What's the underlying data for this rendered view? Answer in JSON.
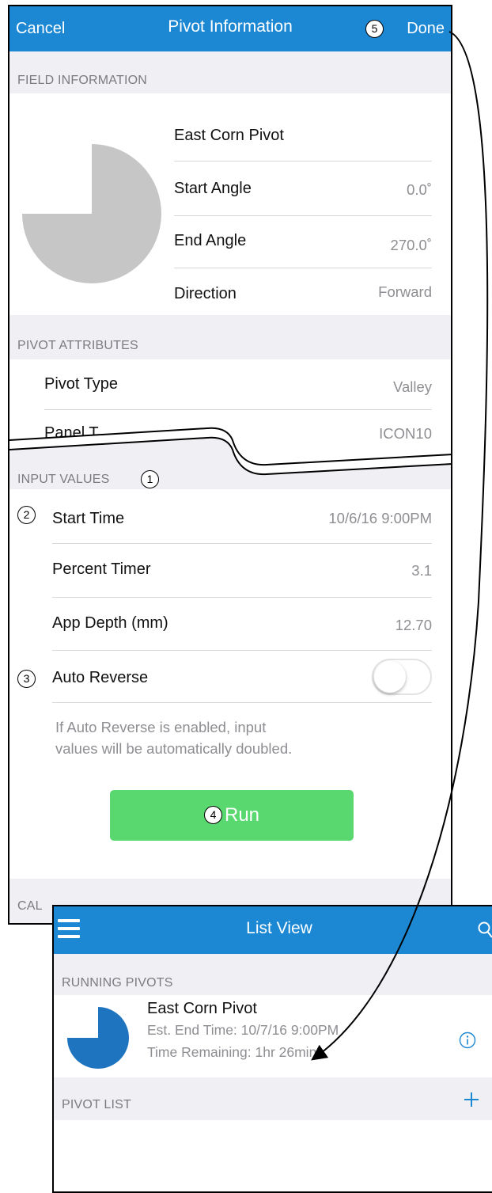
{
  "pivot_info": {
    "nav": {
      "cancel": "Cancel",
      "title": "Pivot Information",
      "done": "Done",
      "done_callout": "5"
    },
    "field_information": {
      "header": "FIELD INFORMATION",
      "name": "East Corn Pivot",
      "start_angle": {
        "label": "Start Angle",
        "value": "0.0˚"
      },
      "end_angle": {
        "label": "End Angle",
        "value": "270.0˚"
      },
      "direction": {
        "label": "Direction",
        "value": "Forward"
      },
      "coverage_fraction": 0.75
    },
    "pivot_attributes": {
      "header": "PIVOT ATTRIBUTES",
      "pivot_type": {
        "label": "Pivot Type",
        "value": "Valley"
      },
      "panel_type": {
        "label": "Panel T",
        "value": "ICON10"
      }
    },
    "input_values": {
      "header": "INPUT VALUES",
      "header_callout": "1",
      "start_time": {
        "label": "Start Time",
        "value": "10/6/16  9:00PM",
        "callout": "2"
      },
      "percent_timer": {
        "label": "Percent Timer",
        "value": "3.1"
      },
      "app_depth": {
        "label": "App Depth (mm)",
        "value": "12.70"
      },
      "auto_reverse": {
        "label": "Auto Reverse",
        "enabled": false,
        "callout": "3"
      },
      "hint_line1": "If Auto Reverse is enabled, input",
      "hint_line2": "values will be automatically doubled.",
      "run_button": {
        "label": "Run",
        "callout": "4",
        "color": "#58d86e"
      }
    },
    "calculated_values": {
      "header": "CAL"
    }
  },
  "list_view": {
    "nav": {
      "title": "List View",
      "menu_icon": "hamburger-icon",
      "search_icon": "search-icon"
    },
    "running_pivots": {
      "header": "RUNNING PIVOTS",
      "item": {
        "name": "East Corn Pivot",
        "end_time": "Est. End Time: 10/7/16  9:00PM",
        "remaining": "Time Remaining: 1hr 26min",
        "coverage_fraction": 0.75,
        "info_icon": "info-icon"
      }
    },
    "pivot_list": {
      "header": "PIVOT LIST",
      "add_icon": "plus-icon"
    }
  },
  "colors": {
    "nav_blue": "#1c88d4",
    "section_gray": "#efeff4",
    "pie_gray": "#c6c6c6",
    "pie_blue": "#1f74bf",
    "run_green": "#58d86e"
  }
}
